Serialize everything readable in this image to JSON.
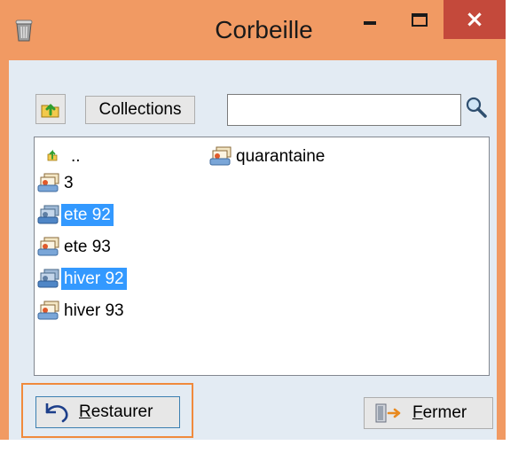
{
  "window": {
    "title": "Corbeille",
    "minimize_glyph": "–",
    "maximize_glyph": "□",
    "close_glyph": "×",
    "frame_color": "#f19a63",
    "close_hover_color": "#c4493b"
  },
  "toolbar": {
    "up_icon": "folder-up-icon",
    "collections_label": "Collections",
    "search_value": "",
    "search_icon": "magnifier-icon"
  },
  "list": {
    "selection_color": "#3399ff",
    "items": [
      {
        "label": "..",
        "icon": "parent-folder-icon",
        "selected": false
      },
      {
        "label": "3",
        "icon": "collection-icon",
        "selected": false
      },
      {
        "label": "ete 92",
        "icon": "collection-icon",
        "selected": true
      },
      {
        "label": "ete 93",
        "icon": "collection-icon",
        "selected": false
      },
      {
        "label": "hiver 92",
        "icon": "collection-icon",
        "selected": true
      },
      {
        "label": "hiver 93",
        "icon": "collection-icon",
        "selected": false
      },
      {
        "label": "quarantaine",
        "icon": "collection-icon",
        "selected": false
      }
    ]
  },
  "buttons": {
    "restore_first": "R",
    "restore_rest": "estaurer",
    "restore_icon": "undo-arrow-icon",
    "close_first": "F",
    "close_rest": "ermer",
    "close_icon": "exit-door-icon",
    "focus_color": "#f08a3c"
  }
}
